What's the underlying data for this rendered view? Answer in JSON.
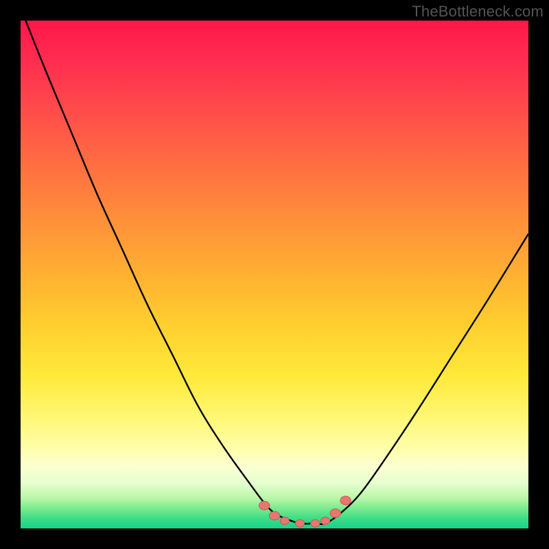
{
  "watermark": "TheBottleneck.com",
  "colors": {
    "frame": "#000000",
    "curve": "#000000",
    "marker_fill": "#e9766f",
    "marker_stroke": "#c45a55"
  },
  "chart_data": {
    "type": "line",
    "title": "",
    "xlabel": "",
    "ylabel": "",
    "xlim": [
      0,
      100
    ],
    "ylim": [
      0,
      100
    ],
    "grid": false,
    "legend": false,
    "series": [
      {
        "name": "bottleneck-curve",
        "x": [
          1,
          5,
          10,
          15,
          20,
          25,
          30,
          35,
          40,
          45,
          48,
          50,
          52,
          55,
          58,
          60,
          63,
          67,
          72,
          78,
          85,
          92,
          100
        ],
        "y": [
          100,
          90,
          78,
          66,
          55,
          44,
          34,
          24,
          16,
          9,
          5,
          3,
          2,
          1,
          1,
          1,
          3,
          7,
          14,
          23,
          34,
          45,
          58
        ]
      }
    ],
    "markers": {
      "name": "highlight-dots",
      "x": [
        48,
        50,
        52,
        55,
        58,
        60,
        62,
        64
      ],
      "y": [
        4.5,
        2.5,
        1.5,
        1,
        1,
        1.5,
        3,
        5.5
      ],
      "size": [
        14,
        14,
        12,
        12,
        12,
        12,
        14,
        14
      ]
    },
    "background_gradient": {
      "stops": [
        {
          "pos": 0,
          "color": "#ff1749"
        },
        {
          "pos": 50,
          "color": "#ffb032"
        },
        {
          "pos": 78,
          "color": "#fff773"
        },
        {
          "pos": 100,
          "color": "#17d38a"
        }
      ]
    }
  }
}
